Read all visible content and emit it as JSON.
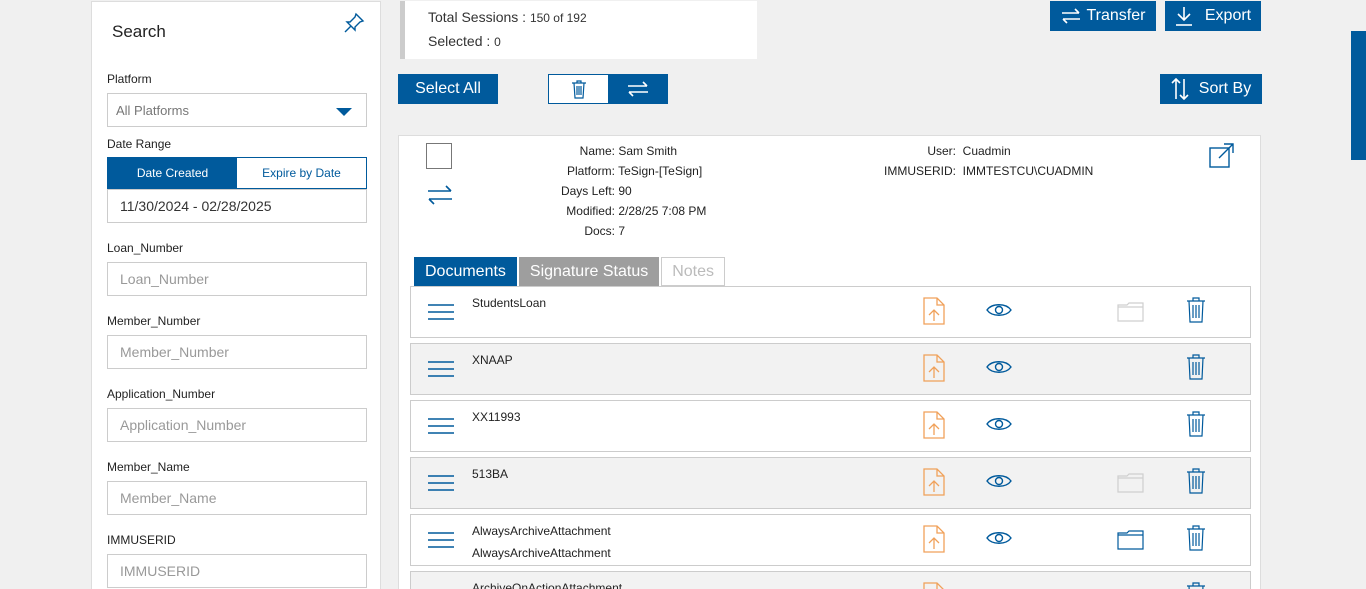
{
  "sidebar": {
    "title": "Search",
    "platform_label": "Platform",
    "platform_value": "All Platforms",
    "date_range_label": "Date Range",
    "date_created": "Date Created",
    "expire_by_date": "Expire by Date",
    "date_value": "11/30/2024 - 02/28/2025",
    "fields": [
      {
        "label": "Loan_Number",
        "placeholder": "Loan_Number"
      },
      {
        "label": "Member_Number",
        "placeholder": "Member_Number"
      },
      {
        "label": "Application_Number",
        "placeholder": "Application_Number"
      },
      {
        "label": "Member_Name",
        "placeholder": "Member_Name"
      },
      {
        "label": "IMMUSERID",
        "placeholder": "IMMUSERID"
      }
    ]
  },
  "summary": {
    "total_label": "Total Sessions : ",
    "total_value": "150 of 192",
    "selected_label": "Selected : ",
    "selected_value": "0"
  },
  "toolbar": {
    "transfer": "Transfer",
    "export": "Export",
    "select_all": "Select All",
    "sort_by": "Sort By"
  },
  "session": {
    "name_label": "Name:",
    "name": "Sam Smith",
    "platform_label": "Platform:",
    "platform": "TeSign-[TeSign]",
    "days_left_label": "Days Left:",
    "days_left": "90",
    "modified_label": "Modified:",
    "modified": "2/28/25 7:08 PM",
    "docs_label": "Docs:",
    "docs": "7",
    "user_label": "User:",
    "user": "Cuadmin",
    "immuserid_label": "IMMUSERID:",
    "immuserid": "IMMTESTCU\\CUADMIN"
  },
  "tabs": {
    "documents": "Documents",
    "signature_status": "Signature Status",
    "notes": "Notes"
  },
  "documents": [
    {
      "line1": "StudentsLoan",
      "line2": "",
      "folder": "light"
    },
    {
      "line1": "XNAAP",
      "line2": "",
      "folder": "none"
    },
    {
      "line1": "XX11993",
      "line2": "",
      "folder": "none"
    },
    {
      "line1": "513BA",
      "line2": "",
      "folder": "light"
    },
    {
      "line1": "AlwaysArchiveAttachment",
      "line2": "AlwaysArchiveAttachment",
      "folder": "blue"
    },
    {
      "line1": "ArchiveOnActionAttachment",
      "line2": "",
      "folder": "none"
    }
  ],
  "colors": {
    "primary": "#005a9c",
    "upload": "#f0a15a",
    "tab_inactive": "#9e9e9e"
  }
}
